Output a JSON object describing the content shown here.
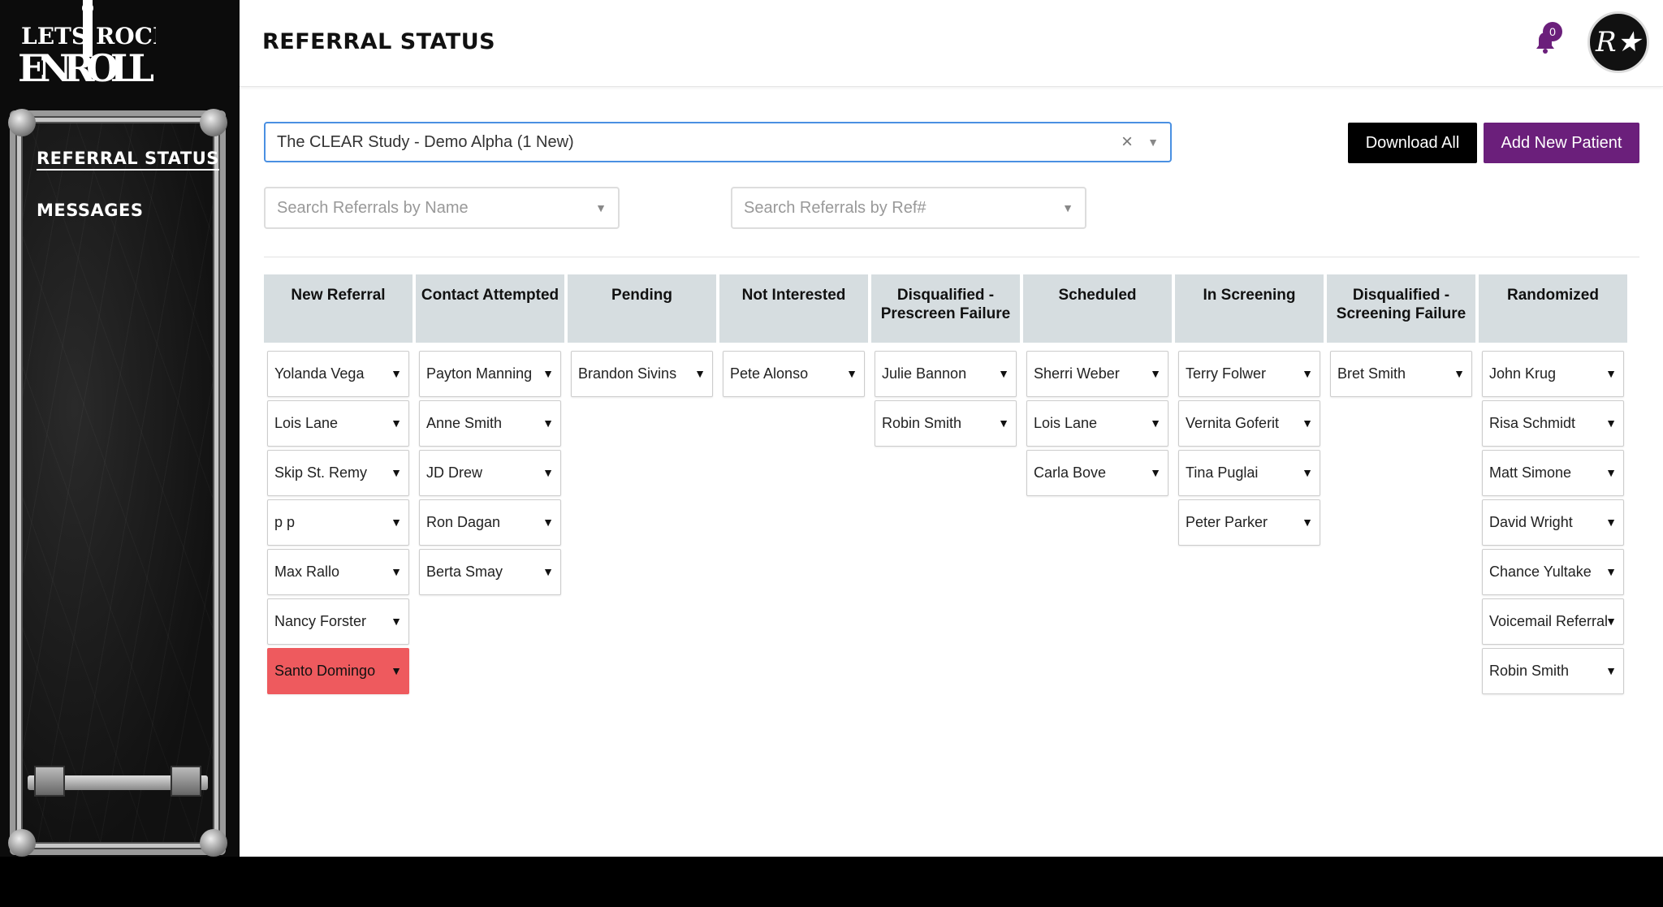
{
  "logo": {
    "line1_left": "LETS",
    "line1_right": "ROCK",
    "line2": "ENROLL"
  },
  "sidebar": {
    "items": [
      {
        "label": "REFERRAL STATUS",
        "active": true
      },
      {
        "label": "MESSAGES",
        "active": false
      }
    ]
  },
  "header": {
    "title": "REFERRAL STATUS",
    "notification_count": "0",
    "avatar_initials": "R★"
  },
  "study_select": {
    "value": "The CLEAR Study - Demo Alpha (1 New)"
  },
  "buttons": {
    "download_all": "Download All",
    "add_patient": "Add New Patient"
  },
  "search": {
    "name_placeholder": "Search Referrals by Name",
    "ref_placeholder": "Search Referrals by Ref#"
  },
  "columns": [
    {
      "title": "New Referral",
      "cards": [
        "Yolanda Vega",
        "Lois Lane",
        "Skip St. Remy",
        "p p",
        "Max Rallo",
        "Nancy Forster",
        "Santo Domingo"
      ]
    },
    {
      "title": "Contact Attempted",
      "cards": [
        "Payton Manning",
        "Anne Smith",
        "JD Drew",
        "Ron Dagan",
        "Berta Smay"
      ]
    },
    {
      "title": "Pending",
      "cards": [
        "Brandon Sivins"
      ]
    },
    {
      "title": "Not Interested",
      "cards": [
        "Pete Alonso"
      ]
    },
    {
      "title": "Disqualified - Prescreen Failure",
      "cards": [
        "Julie Bannon",
        "Robin Smith"
      ]
    },
    {
      "title": "Scheduled",
      "cards": [
        "Sherri Weber",
        "Lois Lane",
        "Carla Bove"
      ]
    },
    {
      "title": "In Screening",
      "cards": [
        "Terry Folwer",
        "Vernita Goferit",
        "Tina Puglai",
        "Peter Parker"
      ]
    },
    {
      "title": "Disqualified - Screening Failure",
      "cards": [
        "Bret Smith"
      ]
    },
    {
      "title": "Randomized",
      "cards": [
        "John Krug",
        "Risa Schmidt",
        "Matt Simone",
        "David Wright",
        "Chance Yultake",
        "Voicemail Referral",
        "Robin Smith"
      ]
    }
  ],
  "colors": {
    "accent": "#6b1f7b",
    "alert_card": "#ee5a5e",
    "column_header": "#d6dde0"
  }
}
